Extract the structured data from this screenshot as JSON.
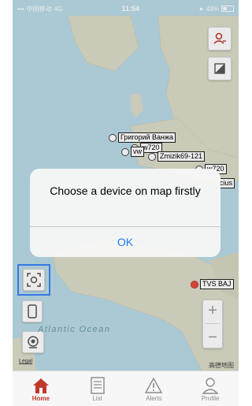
{
  "status_bar": {
    "carrier": "中国移动",
    "network": "4G",
    "time": "11:54",
    "battery": "43%"
  },
  "map": {
    "ocean_label": "Atlantic Ocean",
    "legal_label": "Legal",
    "attribution": "高德地图",
    "markers": [
      {
        "label": "Григорий Ванжа"
      },
      {
        "label": "w720"
      },
      {
        "label": "vw"
      },
      {
        "label": "Zmizik69-121"
      },
      {
        "label": "w720"
      },
      {
        "label": "icius"
      },
      {
        "label": "TVS BAJ"
      }
    ],
    "zoom_in": "+",
    "zoom_out": "−"
  },
  "dialog": {
    "message": "Choose a device on map firstly",
    "ok_label": "OK"
  },
  "tabs": [
    {
      "label": "Home",
      "icon": "home-icon",
      "active": true
    },
    {
      "label": "List",
      "icon": "list-icon",
      "active": false
    },
    {
      "label": "Alerts",
      "icon": "alert-icon",
      "active": false
    },
    {
      "label": "Profile",
      "icon": "profile-icon",
      "active": false
    }
  ],
  "colors": {
    "accent": "#c0392b",
    "link": "#1a7cf2",
    "water": "#b9dbe6",
    "land": "#dcdcc8"
  }
}
